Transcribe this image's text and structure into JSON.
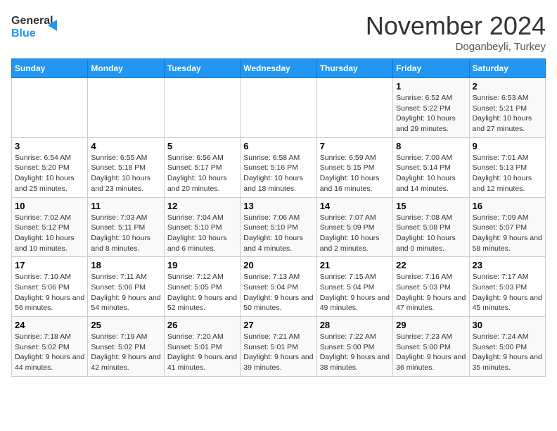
{
  "header": {
    "logo": {
      "line1": "General",
      "line2": "Blue"
    },
    "title": "November 2024",
    "subtitle": "Doganbeyli, Turkey"
  },
  "days_of_week": [
    "Sunday",
    "Monday",
    "Tuesday",
    "Wednesday",
    "Thursday",
    "Friday",
    "Saturday"
  ],
  "weeks": [
    [
      {
        "day": "",
        "info": ""
      },
      {
        "day": "",
        "info": ""
      },
      {
        "day": "",
        "info": ""
      },
      {
        "day": "",
        "info": ""
      },
      {
        "day": "",
        "info": ""
      },
      {
        "day": "1",
        "info": "Sunrise: 6:52 AM\nSunset: 5:22 PM\nDaylight: 10 hours and 29 minutes."
      },
      {
        "day": "2",
        "info": "Sunrise: 6:53 AM\nSunset: 5:21 PM\nDaylight: 10 hours and 27 minutes."
      }
    ],
    [
      {
        "day": "3",
        "info": "Sunrise: 6:54 AM\nSunset: 5:20 PM\nDaylight: 10 hours and 25 minutes."
      },
      {
        "day": "4",
        "info": "Sunrise: 6:55 AM\nSunset: 5:18 PM\nDaylight: 10 hours and 23 minutes."
      },
      {
        "day": "5",
        "info": "Sunrise: 6:56 AM\nSunset: 5:17 PM\nDaylight: 10 hours and 20 minutes."
      },
      {
        "day": "6",
        "info": "Sunrise: 6:58 AM\nSunset: 5:16 PM\nDaylight: 10 hours and 18 minutes."
      },
      {
        "day": "7",
        "info": "Sunrise: 6:59 AM\nSunset: 5:15 PM\nDaylight: 10 hours and 16 minutes."
      },
      {
        "day": "8",
        "info": "Sunrise: 7:00 AM\nSunset: 5:14 PM\nDaylight: 10 hours and 14 minutes."
      },
      {
        "day": "9",
        "info": "Sunrise: 7:01 AM\nSunset: 5:13 PM\nDaylight: 10 hours and 12 minutes."
      }
    ],
    [
      {
        "day": "10",
        "info": "Sunrise: 7:02 AM\nSunset: 5:12 PM\nDaylight: 10 hours and 10 minutes."
      },
      {
        "day": "11",
        "info": "Sunrise: 7:03 AM\nSunset: 5:11 PM\nDaylight: 10 hours and 8 minutes."
      },
      {
        "day": "12",
        "info": "Sunrise: 7:04 AM\nSunset: 5:10 PM\nDaylight: 10 hours and 6 minutes."
      },
      {
        "day": "13",
        "info": "Sunrise: 7:06 AM\nSunset: 5:10 PM\nDaylight: 10 hours and 4 minutes."
      },
      {
        "day": "14",
        "info": "Sunrise: 7:07 AM\nSunset: 5:09 PM\nDaylight: 10 hours and 2 minutes."
      },
      {
        "day": "15",
        "info": "Sunrise: 7:08 AM\nSunset: 5:08 PM\nDaylight: 10 hours and 0 minutes."
      },
      {
        "day": "16",
        "info": "Sunrise: 7:09 AM\nSunset: 5:07 PM\nDaylight: 9 hours and 58 minutes."
      }
    ],
    [
      {
        "day": "17",
        "info": "Sunrise: 7:10 AM\nSunset: 5:06 PM\nDaylight: 9 hours and 56 minutes."
      },
      {
        "day": "18",
        "info": "Sunrise: 7:11 AM\nSunset: 5:06 PM\nDaylight: 9 hours and 54 minutes."
      },
      {
        "day": "19",
        "info": "Sunrise: 7:12 AM\nSunset: 5:05 PM\nDaylight: 9 hours and 52 minutes."
      },
      {
        "day": "20",
        "info": "Sunrise: 7:13 AM\nSunset: 5:04 PM\nDaylight: 9 hours and 50 minutes."
      },
      {
        "day": "21",
        "info": "Sunrise: 7:15 AM\nSunset: 5:04 PM\nDaylight: 9 hours and 49 minutes."
      },
      {
        "day": "22",
        "info": "Sunrise: 7:16 AM\nSunset: 5:03 PM\nDaylight: 9 hours and 47 minutes."
      },
      {
        "day": "23",
        "info": "Sunrise: 7:17 AM\nSunset: 5:03 PM\nDaylight: 9 hours and 45 minutes."
      }
    ],
    [
      {
        "day": "24",
        "info": "Sunrise: 7:18 AM\nSunset: 5:02 PM\nDaylight: 9 hours and 44 minutes."
      },
      {
        "day": "25",
        "info": "Sunrise: 7:19 AM\nSunset: 5:02 PM\nDaylight: 9 hours and 42 minutes."
      },
      {
        "day": "26",
        "info": "Sunrise: 7:20 AM\nSunset: 5:01 PM\nDaylight: 9 hours and 41 minutes."
      },
      {
        "day": "27",
        "info": "Sunrise: 7:21 AM\nSunset: 5:01 PM\nDaylight: 9 hours and 39 minutes."
      },
      {
        "day": "28",
        "info": "Sunrise: 7:22 AM\nSunset: 5:00 PM\nDaylight: 9 hours and 38 minutes."
      },
      {
        "day": "29",
        "info": "Sunrise: 7:23 AM\nSunset: 5:00 PM\nDaylight: 9 hours and 36 minutes."
      },
      {
        "day": "30",
        "info": "Sunrise: 7:24 AM\nSunset: 5:00 PM\nDaylight: 9 hours and 35 minutes."
      }
    ]
  ]
}
